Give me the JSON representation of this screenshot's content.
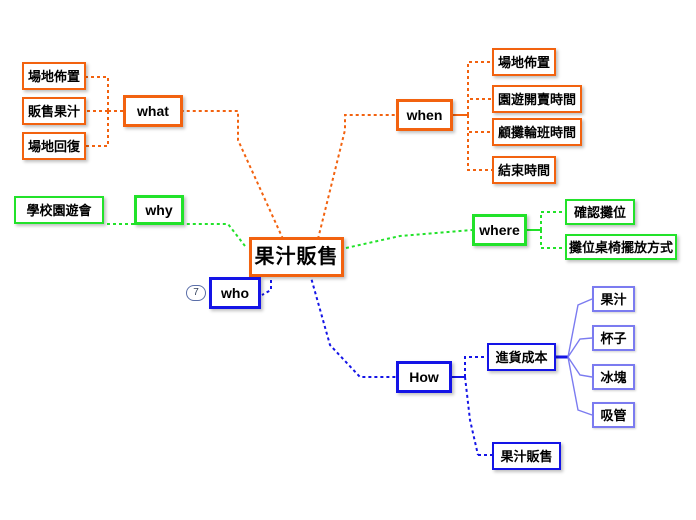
{
  "diagram": {
    "title": "果汁販售",
    "type": "mind-map",
    "colors": {
      "orange": "#f2620f",
      "green": "#22e22a",
      "blue": "#1414e6",
      "blue_light": "#7b7bf0",
      "badge": "#5a6ea8"
    }
  },
  "center": {
    "label": "果汁販售"
  },
  "branches": {
    "what": {
      "label": "what",
      "color": "#f2620f",
      "children": [
        {
          "label": "場地佈置"
        },
        {
          "label": "販售果汁"
        },
        {
          "label": "場地回復"
        }
      ]
    },
    "when": {
      "label": "when",
      "color": "#f2620f",
      "children": [
        {
          "label": "場地佈置"
        },
        {
          "label": "園遊開賣時間"
        },
        {
          "label": "顧攤輪班時間"
        },
        {
          "label": "結束時間"
        }
      ]
    },
    "why": {
      "label": "why",
      "color": "#22e22a",
      "children": [
        {
          "label": "學校園遊會"
        }
      ]
    },
    "where": {
      "label": "where",
      "color": "#22e22a",
      "children": [
        {
          "label": "確認攤位"
        },
        {
          "label": "攤位桌椅擺放方式"
        }
      ]
    },
    "who": {
      "label": "who",
      "color": "#1414e6",
      "badge": "7",
      "children": []
    },
    "how": {
      "label": "How",
      "color": "#1414e6",
      "children": [
        {
          "label": "進貨成本",
          "children": [
            {
              "label": "果汁"
            },
            {
              "label": "杯子"
            },
            {
              "label": "冰塊"
            },
            {
              "label": "吸管"
            }
          ]
        },
        {
          "label": "果汁販售"
        }
      ]
    }
  }
}
